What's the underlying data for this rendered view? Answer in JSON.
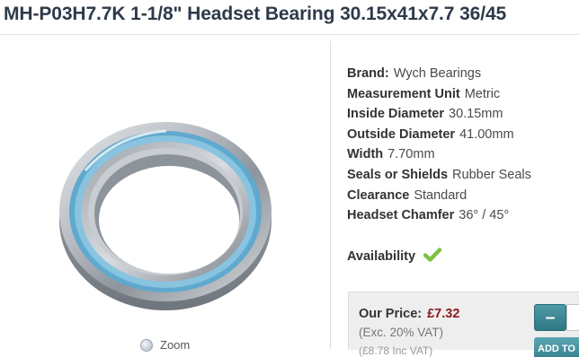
{
  "product": {
    "title": "MH-P03H7.7K 1-1/8\" Headset Bearing 30.15x41x7.7 36/45"
  },
  "image": {
    "zoom_label": "Zoom"
  },
  "specs": [
    {
      "label": "Brand:",
      "value": "Wych Bearings"
    },
    {
      "label": "Measurement Unit",
      "value": "Metric"
    },
    {
      "label": "Inside Diameter",
      "value": "30.15mm"
    },
    {
      "label": "Outside Diameter",
      "value": "41.00mm"
    },
    {
      "label": "Width",
      "value": "7.70mm"
    },
    {
      "label": "Seals or Shields",
      "value": "Rubber Seals"
    },
    {
      "label": "Clearance",
      "value": "Standard"
    },
    {
      "label": "Headset Chamfer",
      "value": "36° / 45°"
    }
  ],
  "availability": {
    "label": "Availability",
    "icon": "check-icon",
    "color": "#7dc142"
  },
  "pricing": {
    "label": "Our Price:",
    "price": "£7.32",
    "vat_note": "(Exc. 20% VAT)",
    "sub_note": "(£8.78 Inc VAT)",
    "price_color": "#8b1a1a"
  },
  "cart": {
    "minus_label": "–",
    "add_label": "ADD TO"
  }
}
